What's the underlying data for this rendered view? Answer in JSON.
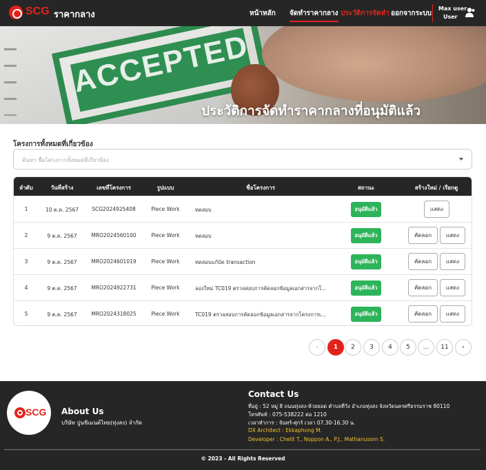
{
  "nav": {
    "brand": "SCG",
    "app_title": "ราคากลาง",
    "links": [
      "หน้าหลัก",
      "จัดทำราคากลาง",
      "ประวัติการจัดทำ",
      "ออกจากระบบ"
    ],
    "user_name": "Max user",
    "user_role": "User"
  },
  "hero": {
    "stamp_text": "ACCEPTED",
    "title": "ประวัติการจัดทำราคากลางที่อนุมัติแล้ว"
  },
  "filter": {
    "label": "โครงการทั้งหมดที่เกี่ยวข้อง",
    "placeholder": "ค้นหา ชื่อโครงการทั้งหมดที่เกี่ยวข้อง"
  },
  "table": {
    "headers": [
      "ลำดับ",
      "วันที่สร้าง",
      "เลขที่โครงการ",
      "รูปแบบ",
      "ชื่อโครงการ",
      "สถานะ",
      "สร้างใหม่ / เรียกดู"
    ],
    "rows": [
      {
        "no": "1",
        "date": "10 ต.ค. 2567",
        "code": "SCG2024925408",
        "type": "Piece Work",
        "name": "ทดสอบ",
        "status": "อนุมัติแล้ว",
        "copy": "",
        "view": "แสดง"
      },
      {
        "no": "2",
        "date": "9 ต.ค. 2567",
        "code": "MRO2024560100",
        "type": "Piece Work",
        "name": "ทดสอบ",
        "status": "อนุมัติแล้ว",
        "copy": "คัดลอก",
        "view": "แสดง"
      },
      {
        "no": "3",
        "date": "9 ต.ค. 2567",
        "code": "MRO2024601019",
        "type": "Piece Work",
        "name": "ทดสอบแก้บัค transaction",
        "status": "อนุมัติแล้ว",
        "copy": "คัดลอก",
        "view": "แสดง"
      },
      {
        "no": "4",
        "date": "9 ต.ค. 2567",
        "code": "MRO2024922731",
        "type": "Piece Work",
        "name": "ลองใหม่ TC019 ตรวจสอบการคัดลอกข้อมูลเอกสารจากโ...",
        "status": "อนุมัติแล้ว",
        "copy": "คัดลอก",
        "view": "แสดง"
      },
      {
        "no": "5",
        "date": "9 ต.ค. 2567",
        "code": "MRO2024318025",
        "type": "Piece Work",
        "name": "TC019 ตรวจสอบการคัดลอกข้อมูลเอกสารจากโครงการเ...",
        "status": "อนุมัติแล้ว",
        "copy": "คัดลอก",
        "view": "แสดง"
      }
    ]
  },
  "pagination": {
    "prev": "‹",
    "pages": [
      "1",
      "2",
      "3",
      "4",
      "5",
      "...",
      "11"
    ],
    "next": "›",
    "current": "1"
  },
  "footer": {
    "logo": "SCG",
    "about_title": "About Us",
    "company": "บริษัท ปูนซิเมนต์ไทย(ทุ่งสง) จำกัด",
    "contact_title": "Contact Us",
    "address": "ที่อยู่ : 52 หมู่ 8 ถนนทุ่งสง-ห้วยยอด ตำบลที่วัง อำเภอทุ่งสง จังหวัดนครศรีธรรมราช 80110",
    "phone": "โทรศัพท์ : 075-538222 ต่อ 1210",
    "hours": "เวลาทำการ : จันทร์-ศุกร์ เวลา 07.30-16.30 น.",
    "dx_architect": "DX Architect : Ekkaphong M.",
    "developer": "Developer : Chelit T., Noppon A., P.J., Mathanusorn S.",
    "copyright": "© 2023 - All Rights Reserved"
  },
  "colors": {
    "primary_red": "#e3231b",
    "dark": "#262626",
    "success_green": "#2db45a",
    "footer_highlight": "#f2c230"
  }
}
